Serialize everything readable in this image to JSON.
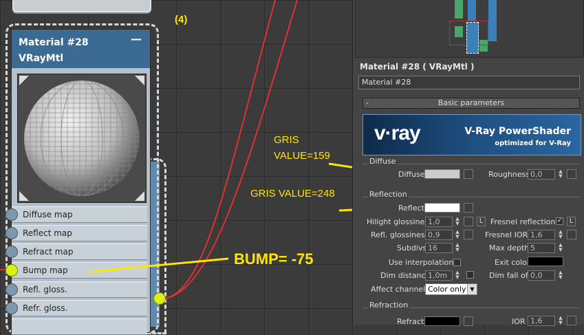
{
  "graph": {
    "step_label": "(4)",
    "node": {
      "title": "Material #28",
      "type": "VRayMtl",
      "minimize": "—",
      "slots": [
        "Diffuse map",
        "Reflect map",
        "Refract map",
        "Bump map",
        "Refl. gloss.",
        "Refr. gloss."
      ]
    }
  },
  "annotations": {
    "diffuse_note_line1": "GRIS",
    "diffuse_note_line2": "VALUE=159",
    "reflect_note": "GRIS VALUE=248",
    "bump_note": "BUMP= -75"
  },
  "editor": {
    "title": "Material #28  ( VRayMtl )",
    "name_value": "Material #28",
    "rollout": {
      "collapse": "-",
      "title": "Basic parameters"
    },
    "banner": {
      "logo": "v·ray",
      "title": "V-Ray PowerShader",
      "subtitle": "optimized for V-Ray"
    },
    "diffuse": {
      "group": "Diffuse",
      "label": "Diffuse",
      "color": "#cccccc",
      "roughness_label": "Roughness",
      "roughness": "0,0"
    },
    "reflection": {
      "group": "Reflection",
      "reflect_label": "Reflect",
      "reflect_color": "#ffffff",
      "hilight_label": "Hilight glossiness",
      "hilight": "1,0",
      "l_label": "L",
      "fresnel_label": "Fresnel reflections",
      "fresnel_checked": "✓",
      "refl_gloss_label": "Refl. glossiness",
      "refl_gloss": "0,9",
      "fresnel_ior_label": "Fresnel IOR",
      "fresnel_ior": "1,6",
      "subdivs_label": "Subdivs",
      "subdivs": "16",
      "max_depth_label": "Max depth",
      "max_depth": "5",
      "use_interp_label": "Use interpolation",
      "exit_color_label": "Exit color",
      "exit_color": "#000000",
      "dim_distance_label": "Dim distance",
      "dim_distance": "1,0m",
      "dim_falloff_label": "Dim fall off",
      "dim_falloff": "0,0",
      "affect_label": "Affect channels",
      "affect_value": "Color only"
    },
    "refraction": {
      "group": "Refraction",
      "refract_label": "Refract",
      "refract_color": "#000000",
      "ior_label": "IOR",
      "ior": "1,6"
    }
  },
  "colors": {
    "node_header": "#3b6a93",
    "active_socket": "#d9f012",
    "wire": "#e03030",
    "annotation": "#ffe600"
  }
}
